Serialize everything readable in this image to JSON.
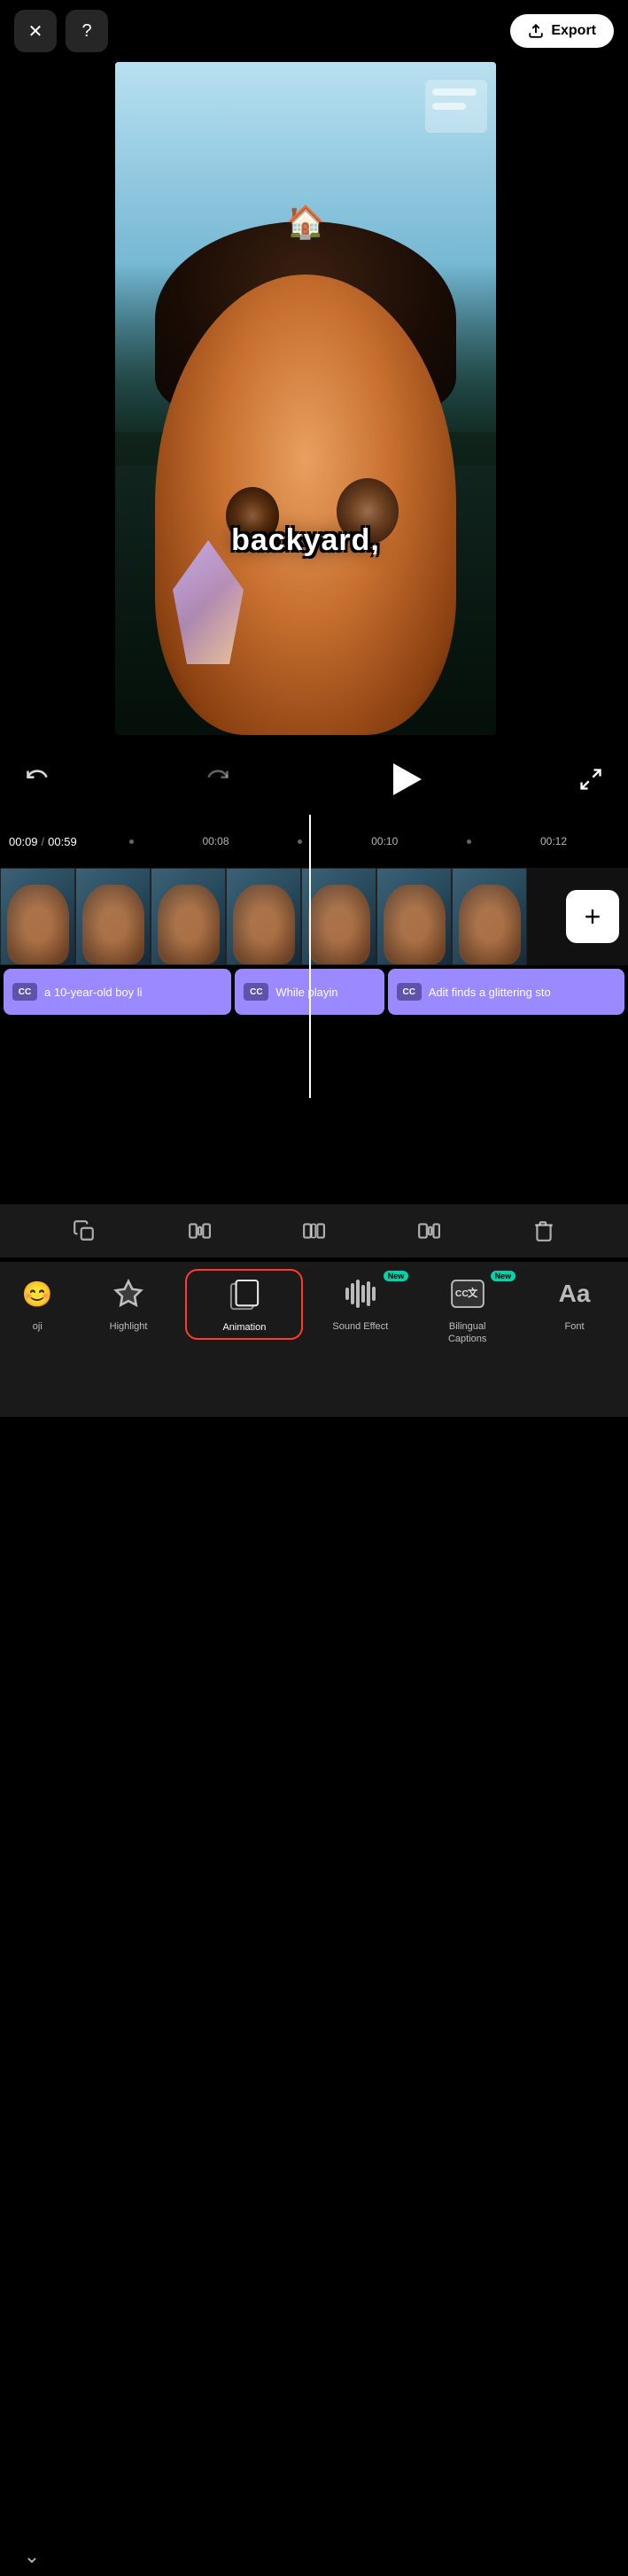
{
  "header": {
    "close_label": "✕",
    "help_label": "?",
    "export_label": "Export"
  },
  "video": {
    "subtitle": "backyard,",
    "house_emoji": "🏠"
  },
  "controls": {
    "undo_label": "↺",
    "redo_label": "↻",
    "play_label": "▶",
    "current_time": "00:09",
    "total_time": "00:59",
    "time_separator": "/",
    "markers": [
      "00:08",
      "00:10",
      "00:12"
    ]
  },
  "timeline": {
    "add_button": "+"
  },
  "captions": [
    {
      "id": 1,
      "text": "a 10-year-old boy li",
      "cc": "cc"
    },
    {
      "id": 2,
      "text": "While playin",
      "cc": "cc"
    },
    {
      "id": 3,
      "text": "Adit finds a glittering sto",
      "cc": "cc"
    }
  ],
  "bottom_toolbar": {
    "icons": [
      "copy",
      "trim-start",
      "trim-mid",
      "trim-end",
      "delete"
    ]
  },
  "bottom_nav": {
    "chevron": "⌄",
    "items": [
      {
        "id": "emoji",
        "label": "oji",
        "badge": null,
        "active": false
      },
      {
        "id": "highlight",
        "label": "Highlight",
        "badge": null,
        "active": false
      },
      {
        "id": "animation",
        "label": "Animation",
        "badge": null,
        "active": true
      },
      {
        "id": "sound-effect",
        "label": "Sound Effect",
        "badge": "New",
        "active": false
      },
      {
        "id": "bilingual-captions",
        "label": "Bilingual\nCaptions",
        "badge": "New",
        "active": false
      },
      {
        "id": "font",
        "label": "Font",
        "badge": null,
        "active": false
      }
    ]
  }
}
